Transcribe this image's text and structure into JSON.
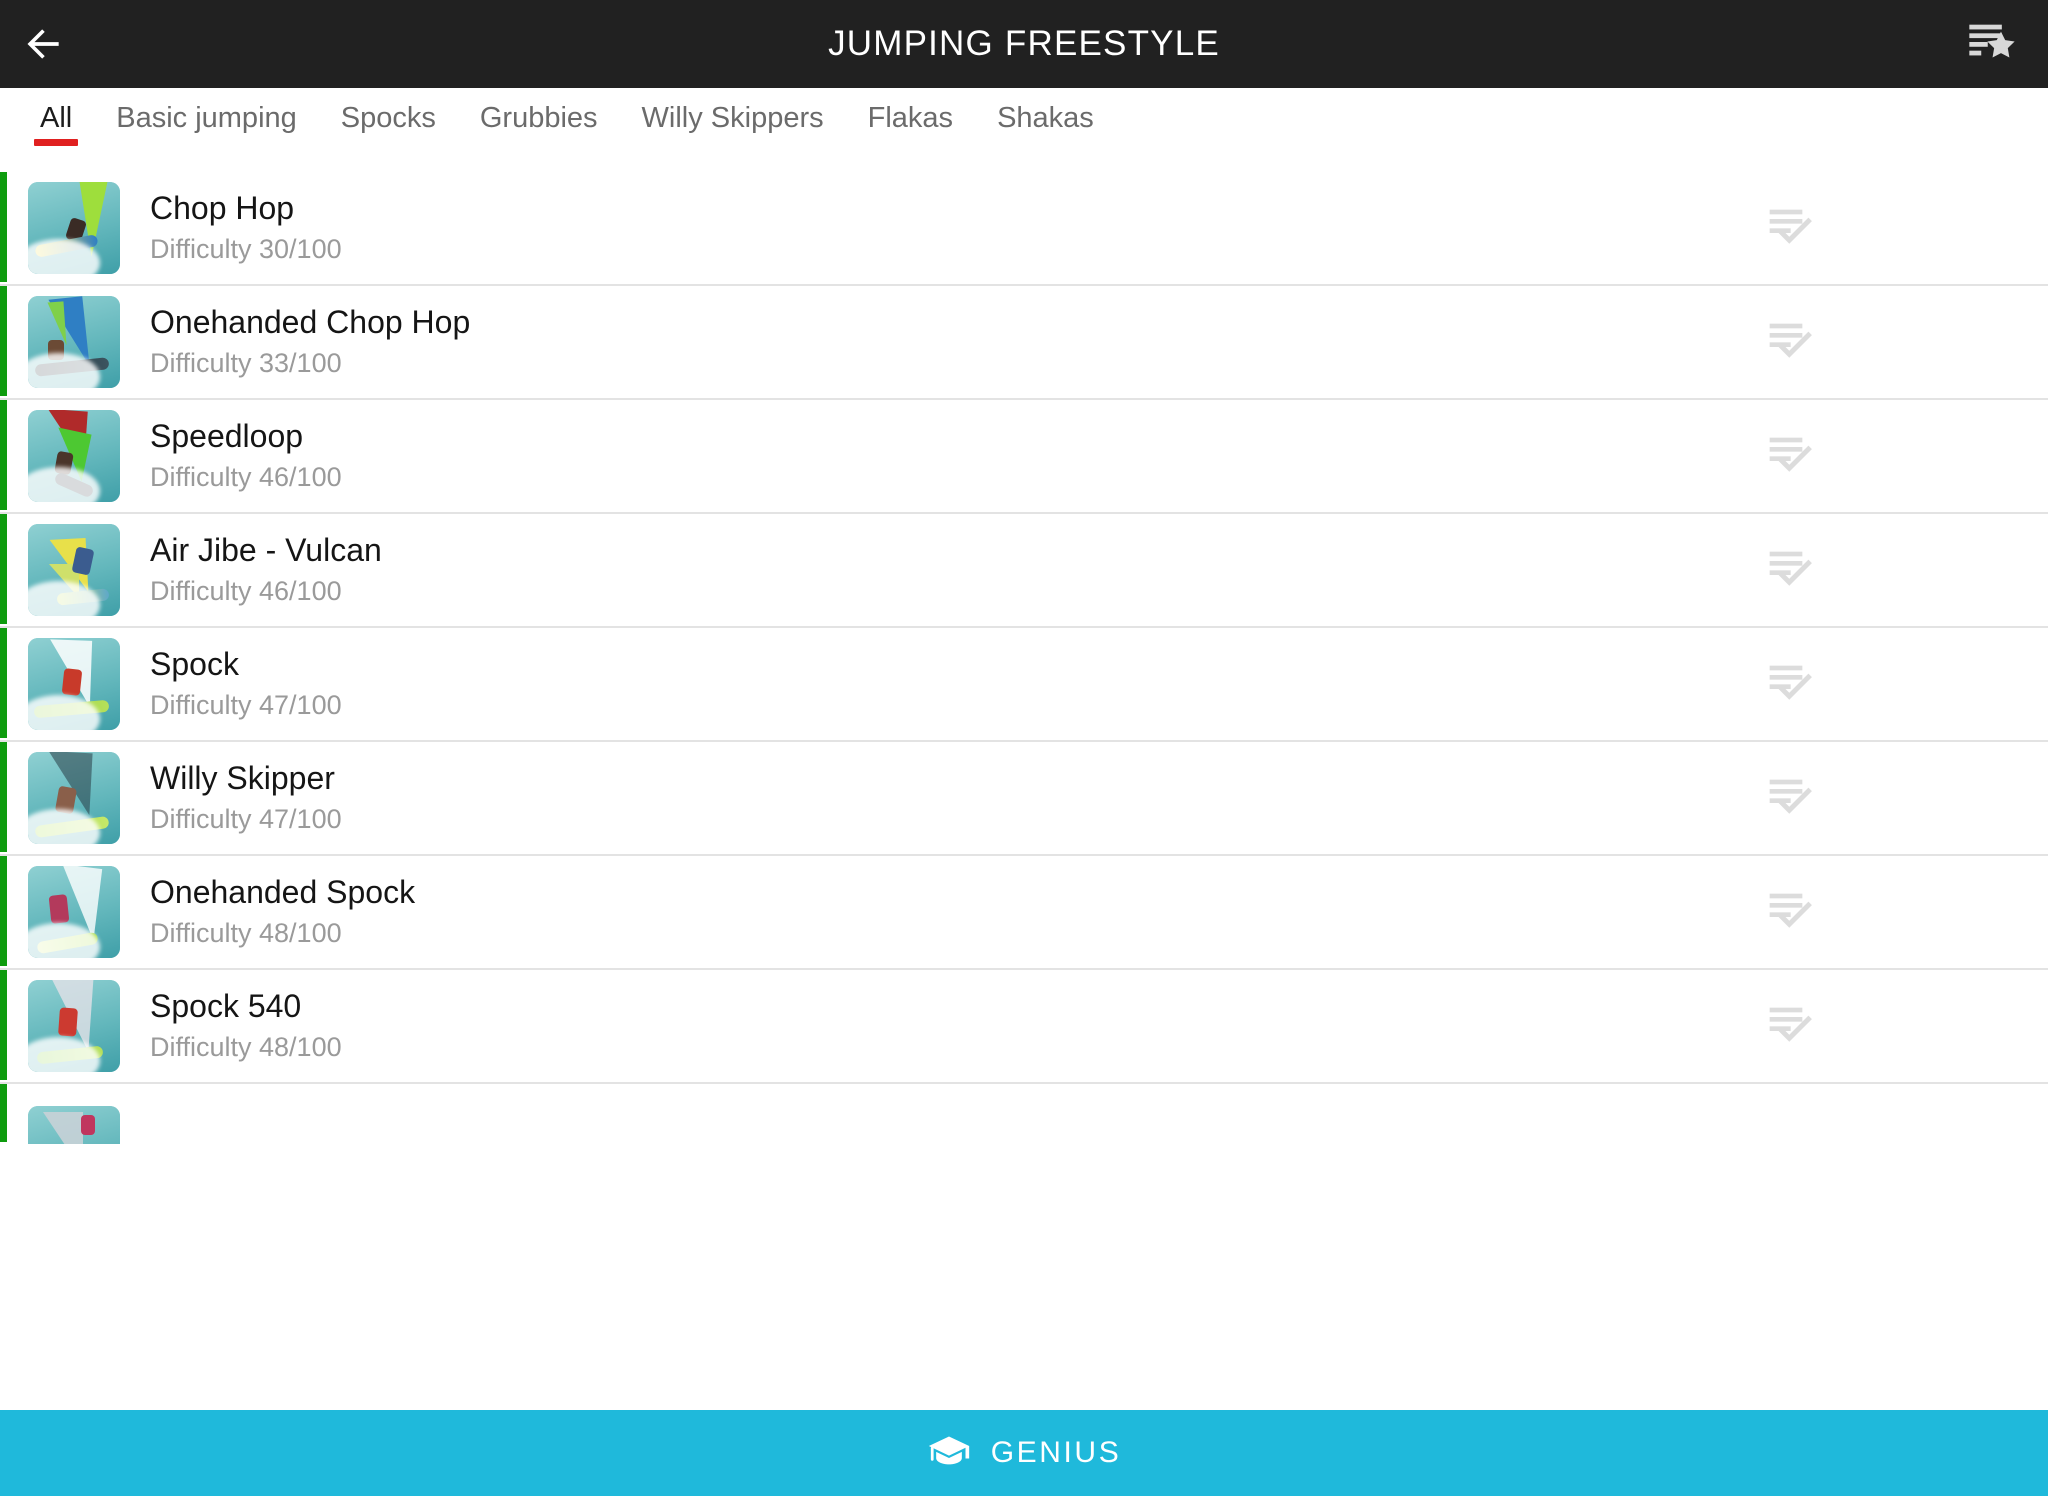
{
  "header": {
    "title": "JUMPING FREESTYLE",
    "back_icon": "arrow-left-icon",
    "action_icon": "playlist-star-icon",
    "background": "#212121",
    "text_color": "#ffffff"
  },
  "tabs": {
    "active_index": 0,
    "indicator_color": "#e02020",
    "items": [
      {
        "label": "All"
      },
      {
        "label": "Basic jumping"
      },
      {
        "label": "Spocks"
      },
      {
        "label": "Grubbies"
      },
      {
        "label": "Willy Skippers"
      },
      {
        "label": "Flakas"
      },
      {
        "label": "Shakas"
      }
    ]
  },
  "list": {
    "status_color": "#0e9c0e",
    "row_action_icon": "playlist-add-check-icon",
    "rows": [
      {
        "title": "Chop Hop",
        "subtitle": "Difficulty 30/100",
        "difficulty": 30,
        "thumb": "windsurfer-green-sail"
      },
      {
        "title": "Onehanded Chop Hop",
        "subtitle": "Difficulty 33/100",
        "difficulty": 33,
        "thumb": "windsurfer-blue-sail"
      },
      {
        "title": "Speedloop",
        "subtitle": "Difficulty 46/100",
        "difficulty": 46,
        "thumb": "windsurfer-red-green-sail"
      },
      {
        "title": "Air Jibe - Vulcan",
        "subtitle": "Difficulty 46/100",
        "difficulty": 46,
        "thumb": "windsurfer-yellow-sail"
      },
      {
        "title": "Spock",
        "subtitle": "Difficulty 47/100",
        "difficulty": 47,
        "thumb": "windsurfer-white-sail-red-rider"
      },
      {
        "title": "Willy Skipper",
        "subtitle": "Difficulty 47/100",
        "difficulty": 47,
        "thumb": "windsurfer-dark-sail"
      },
      {
        "title": "Onehanded Spock",
        "subtitle": "Difficulty 48/100",
        "difficulty": 48,
        "thumb": "windsurfer-white-sail-pink-rider"
      },
      {
        "title": "Spock 540",
        "subtitle": "Difficulty 48/100",
        "difficulty": 48,
        "thumb": "windsurfer-grey-sail-red-rider"
      },
      {
        "title": "",
        "subtitle": "",
        "difficulty": null,
        "thumb": "windsurfer-partial"
      }
    ]
  },
  "bottom_bar": {
    "label": "GENIUS",
    "icon": "graduation-cap-icon",
    "background": "#1fb9db",
    "text_color": "#ffffff"
  }
}
